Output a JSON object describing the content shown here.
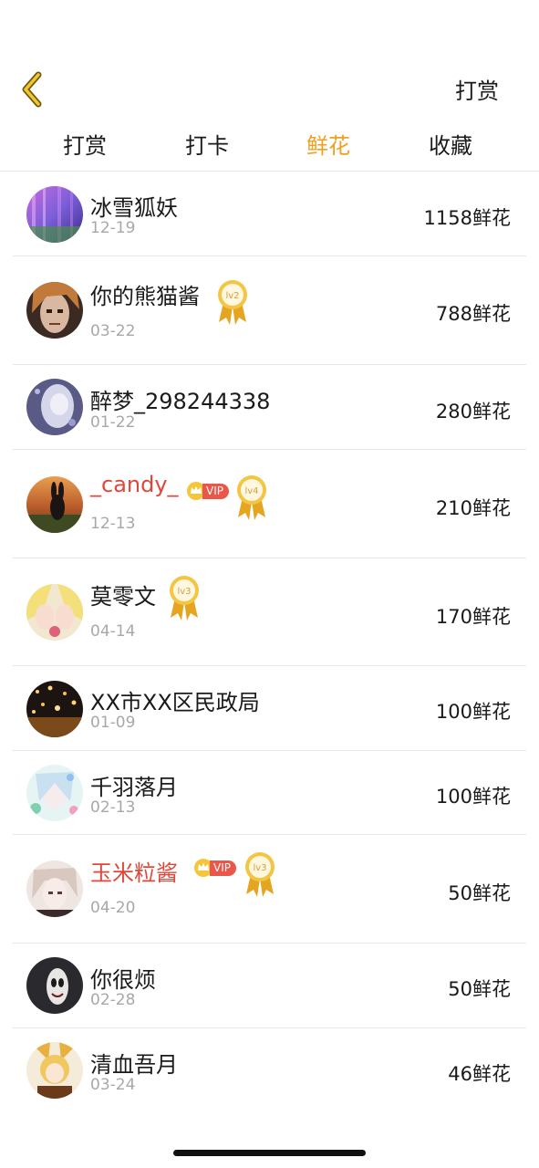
{
  "header": {
    "back_icon": "chevron-left-icon",
    "action_label": "打赏"
  },
  "tabs": [
    {
      "label": "打赏",
      "active": false
    },
    {
      "label": "打卡",
      "active": false
    },
    {
      "label": "鲜花",
      "active": true
    },
    {
      "label": "收藏",
      "active": false
    }
  ],
  "accent_color": "#f0a020",
  "vip_name_color": "#e0473a",
  "vip_badge_label": "VIP",
  "rows": [
    {
      "name": "冰雪狐妖",
      "date": "12-19",
      "amount": "1158鲜花",
      "vip": false,
      "level": ""
    },
    {
      "name": "你的熊猫酱",
      "date": "03-22",
      "amount": "788鲜花",
      "vip": false,
      "level": "lv2"
    },
    {
      "name": "醉梦_298244338",
      "date": "01-22",
      "amount": "280鲜花",
      "vip": false,
      "level": ""
    },
    {
      "name": "_candy_",
      "date": "12-13",
      "amount": "210鲜花",
      "vip": true,
      "level": "lv4"
    },
    {
      "name": "莫零文",
      "date": "04-14",
      "amount": "170鲜花",
      "vip": false,
      "level": "lv3"
    },
    {
      "name": "XX市XX区民政局",
      "date": "01-09",
      "amount": "100鲜花",
      "vip": false,
      "level": ""
    },
    {
      "name": "千羽落月",
      "date": "02-13",
      "amount": "100鲜花",
      "vip": false,
      "level": ""
    },
    {
      "name": "玉米粒酱",
      "date": "04-20",
      "amount": "50鲜花",
      "vip": true,
      "level": "lv3"
    },
    {
      "name": "你很烦",
      "date": "02-28",
      "amount": "50鲜花",
      "vip": false,
      "level": ""
    },
    {
      "name": "清血吾月",
      "date": "03-24",
      "amount": "46鲜花",
      "vip": false,
      "level": ""
    }
  ]
}
